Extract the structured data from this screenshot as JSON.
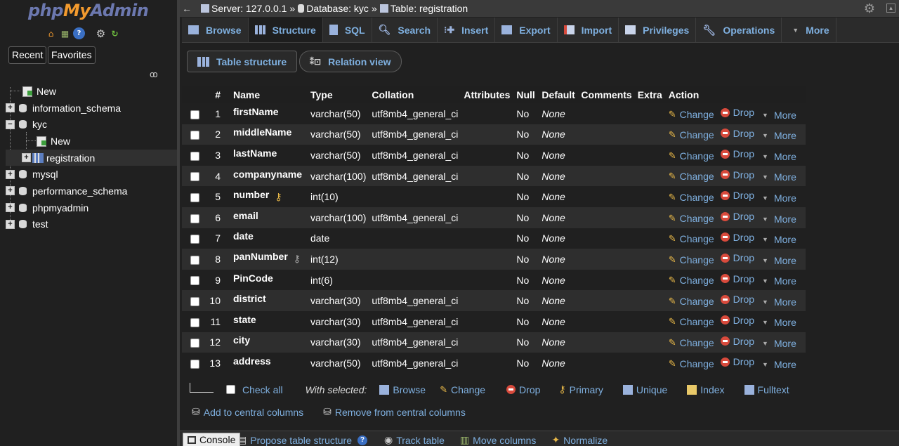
{
  "logo": {
    "part1": "php",
    "part2": "My",
    "part3": "Admin"
  },
  "nav_buttons": {
    "recent": "Recent",
    "favorites": "Favorites"
  },
  "tree": [
    {
      "label": "New",
      "kind": "new",
      "level": 0
    },
    {
      "label": "information_schema",
      "kind": "db",
      "level": 0,
      "expander": "+"
    },
    {
      "label": "kyc",
      "kind": "db",
      "level": 0,
      "expander": "−"
    },
    {
      "label": "New",
      "kind": "new",
      "level": 1
    },
    {
      "label": "registration",
      "kind": "table",
      "level": 1,
      "expander": "+",
      "selected": true
    },
    {
      "label": "mysql",
      "kind": "db",
      "level": 0,
      "expander": "+"
    },
    {
      "label": "performance_schema",
      "kind": "db",
      "level": 0,
      "expander": "+"
    },
    {
      "label": "phpmyadmin",
      "kind": "db",
      "level": 0,
      "expander": "+"
    },
    {
      "label": "test",
      "kind": "db",
      "level": 0,
      "expander": "+"
    }
  ],
  "breadcrumb": {
    "server": "Server: 127.0.0.1",
    "database": "Database: kyc",
    "table": "Table: registration",
    "sep": "»"
  },
  "tabs": [
    {
      "label": "Browse",
      "icon": "browse-icon"
    },
    {
      "label": "Structure",
      "icon": "structure-icon",
      "active": true
    },
    {
      "label": "SQL",
      "icon": "sql-icon"
    },
    {
      "label": "Search",
      "icon": "search-icon"
    },
    {
      "label": "Insert",
      "icon": "insert-icon"
    },
    {
      "label": "Export",
      "icon": "export-icon"
    },
    {
      "label": "Import",
      "icon": "import-icon"
    },
    {
      "label": "Privileges",
      "icon": "privileges-icon"
    },
    {
      "label": "Operations",
      "icon": "operations-icon"
    },
    {
      "label": "More",
      "icon": "caret-down-icon"
    }
  ],
  "subtabs": {
    "structure": "Table structure",
    "relation": "Relation view"
  },
  "columns": {
    "hash": "#",
    "name": "Name",
    "type": "Type",
    "collation": "Collation",
    "attributes": "Attributes",
    "null": "Null",
    "default": "Default",
    "comments": "Comments",
    "extra": "Extra",
    "action": "Action"
  },
  "rows": [
    {
      "n": "1",
      "name": "firstName",
      "type": "varchar(50)",
      "collation": "utf8mb4_general_ci",
      "null": "No",
      "default": "None",
      "key": ""
    },
    {
      "n": "2",
      "name": "middleName",
      "type": "varchar(50)",
      "collation": "utf8mb4_general_ci",
      "null": "No",
      "default": "None",
      "key": ""
    },
    {
      "n": "3",
      "name": "lastName",
      "type": "varchar(50)",
      "collation": "utf8mb4_general_ci",
      "null": "No",
      "default": "None",
      "key": ""
    },
    {
      "n": "4",
      "name": "companyname",
      "type": "varchar(100)",
      "collation": "utf8mb4_general_ci",
      "null": "No",
      "default": "None",
      "key": ""
    },
    {
      "n": "5",
      "name": "number",
      "type": "int(10)",
      "collation": "",
      "null": "No",
      "default": "None",
      "key": "primary"
    },
    {
      "n": "6",
      "name": "email",
      "type": "varchar(100)",
      "collation": "utf8mb4_general_ci",
      "null": "No",
      "default": "None",
      "key": ""
    },
    {
      "n": "7",
      "name": "date",
      "type": "date",
      "collation": "",
      "null": "No",
      "default": "None",
      "key": ""
    },
    {
      "n": "8",
      "name": "panNumber",
      "type": "int(12)",
      "collation": "",
      "null": "No",
      "default": "None",
      "key": "unique"
    },
    {
      "n": "9",
      "name": "PinCode",
      "type": "int(6)",
      "collation": "",
      "null": "No",
      "default": "None",
      "key": ""
    },
    {
      "n": "10",
      "name": "district",
      "type": "varchar(30)",
      "collation": "utf8mb4_general_ci",
      "null": "No",
      "default": "None",
      "key": ""
    },
    {
      "n": "11",
      "name": "state",
      "type": "varchar(30)",
      "collation": "utf8mb4_general_ci",
      "null": "No",
      "default": "None",
      "key": ""
    },
    {
      "n": "12",
      "name": "city",
      "type": "varchar(30)",
      "collation": "utf8mb4_general_ci",
      "null": "No",
      "default": "None",
      "key": ""
    },
    {
      "n": "13",
      "name": "address",
      "type": "varchar(50)",
      "collation": "utf8mb4_general_ci",
      "null": "No",
      "default": "None",
      "key": ""
    }
  ],
  "row_actions": {
    "change": "Change",
    "drop": "Drop",
    "more": "More"
  },
  "bulk": {
    "check_all": "Check all",
    "with_selected": "With selected:",
    "browse": "Browse",
    "change": "Change",
    "drop": "Drop",
    "primary": "Primary",
    "unique": "Unique",
    "index": "Index",
    "fulltext": "Fulltext",
    "add_central": "Add to central columns",
    "remove_central": "Remove from central columns"
  },
  "footer_links": {
    "console": "Console",
    "propose": "Propose table structure",
    "track": "Track table",
    "move": "Move columns",
    "normalize": "Normalize"
  },
  "colors": {
    "link": "#7fb0e0",
    "bg": "#202020",
    "row_alt": "#2e2e2e",
    "drop": "#d84a3c",
    "key": "#e8b848"
  }
}
